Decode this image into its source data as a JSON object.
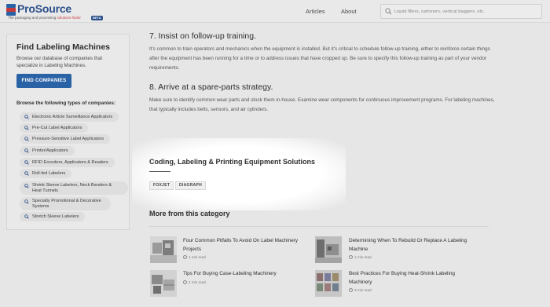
{
  "header": {
    "brand": "ProSource",
    "tagline_prefix": "The packaging and processing ",
    "tagline_highlight": "solutions finder",
    "beta": "BETA",
    "nav": [
      "Articles",
      "About"
    ],
    "search_placeholder": "Liquid fillers, cartoners, vertical baggers, etc."
  },
  "sidebar": {
    "title": "Find Labeling Machines",
    "description": "Browse our database of companies that specialize in Labeling Machines.",
    "button": "FIND COMPANIES",
    "subtitle": "Browse the following types of companies:",
    "items": [
      "Electronic Article Surveillance Applicators",
      "Pre-Cut Label Applicators",
      "Pressure-Sensitive Label Applicators",
      "Printer/Applicators",
      "RFID Encoders, Applicators & Readers",
      "Roll-fed Labelers",
      "Shrink Sleeve Labelers, Neck Banders & Heat Tunnels",
      "Specialty Promotional & Decorative Systems",
      "Stretch Sleeve Labelers"
    ]
  },
  "article": {
    "h7": "7. Insist on follow-up training.",
    "p7": "It’s common to train operators and mechanics when the equipment is installed. But it’s critical to schedule follow-up training, either to reinforce certain things after the equipment has been running for a time or to address issues that have cropped up. Be sure to specify this follow-up training as part of your vendor requirements.",
    "h8": "8. Arrive at a spare-parts strategy.",
    "p8": "Make sure to identify common wear parts and stock them in-house. Examine wear components for continuous improvement programs. For labeling machines, that typically includes belts, sensors, and air cylinders."
  },
  "solutions": {
    "title": "Coding, Labeling & Printing Equipment Solutions",
    "tags": [
      "FOXJET",
      "DIAGRAPH"
    ]
  },
  "more": {
    "title": "More from this category",
    "articles": [
      {
        "title": "Four Common Pitfalls To Avoid On Label Machinery Projects",
        "meta": "1 min read"
      },
      {
        "title": "Determining When To Rebuild Or Replace A Labeling Machine",
        "meta": "1 min read"
      },
      {
        "title": "Tips For Buying Case-Labeling Machinery",
        "meta": "2 min read"
      },
      {
        "title": "Best Practices For Buying Heat-Shrink Labeling Machinery",
        "meta": "3 min read"
      }
    ]
  },
  "colors": {
    "accent": "#2a62a6",
    "brand": "#2a4f8a",
    "highlight": "#c8393b"
  }
}
